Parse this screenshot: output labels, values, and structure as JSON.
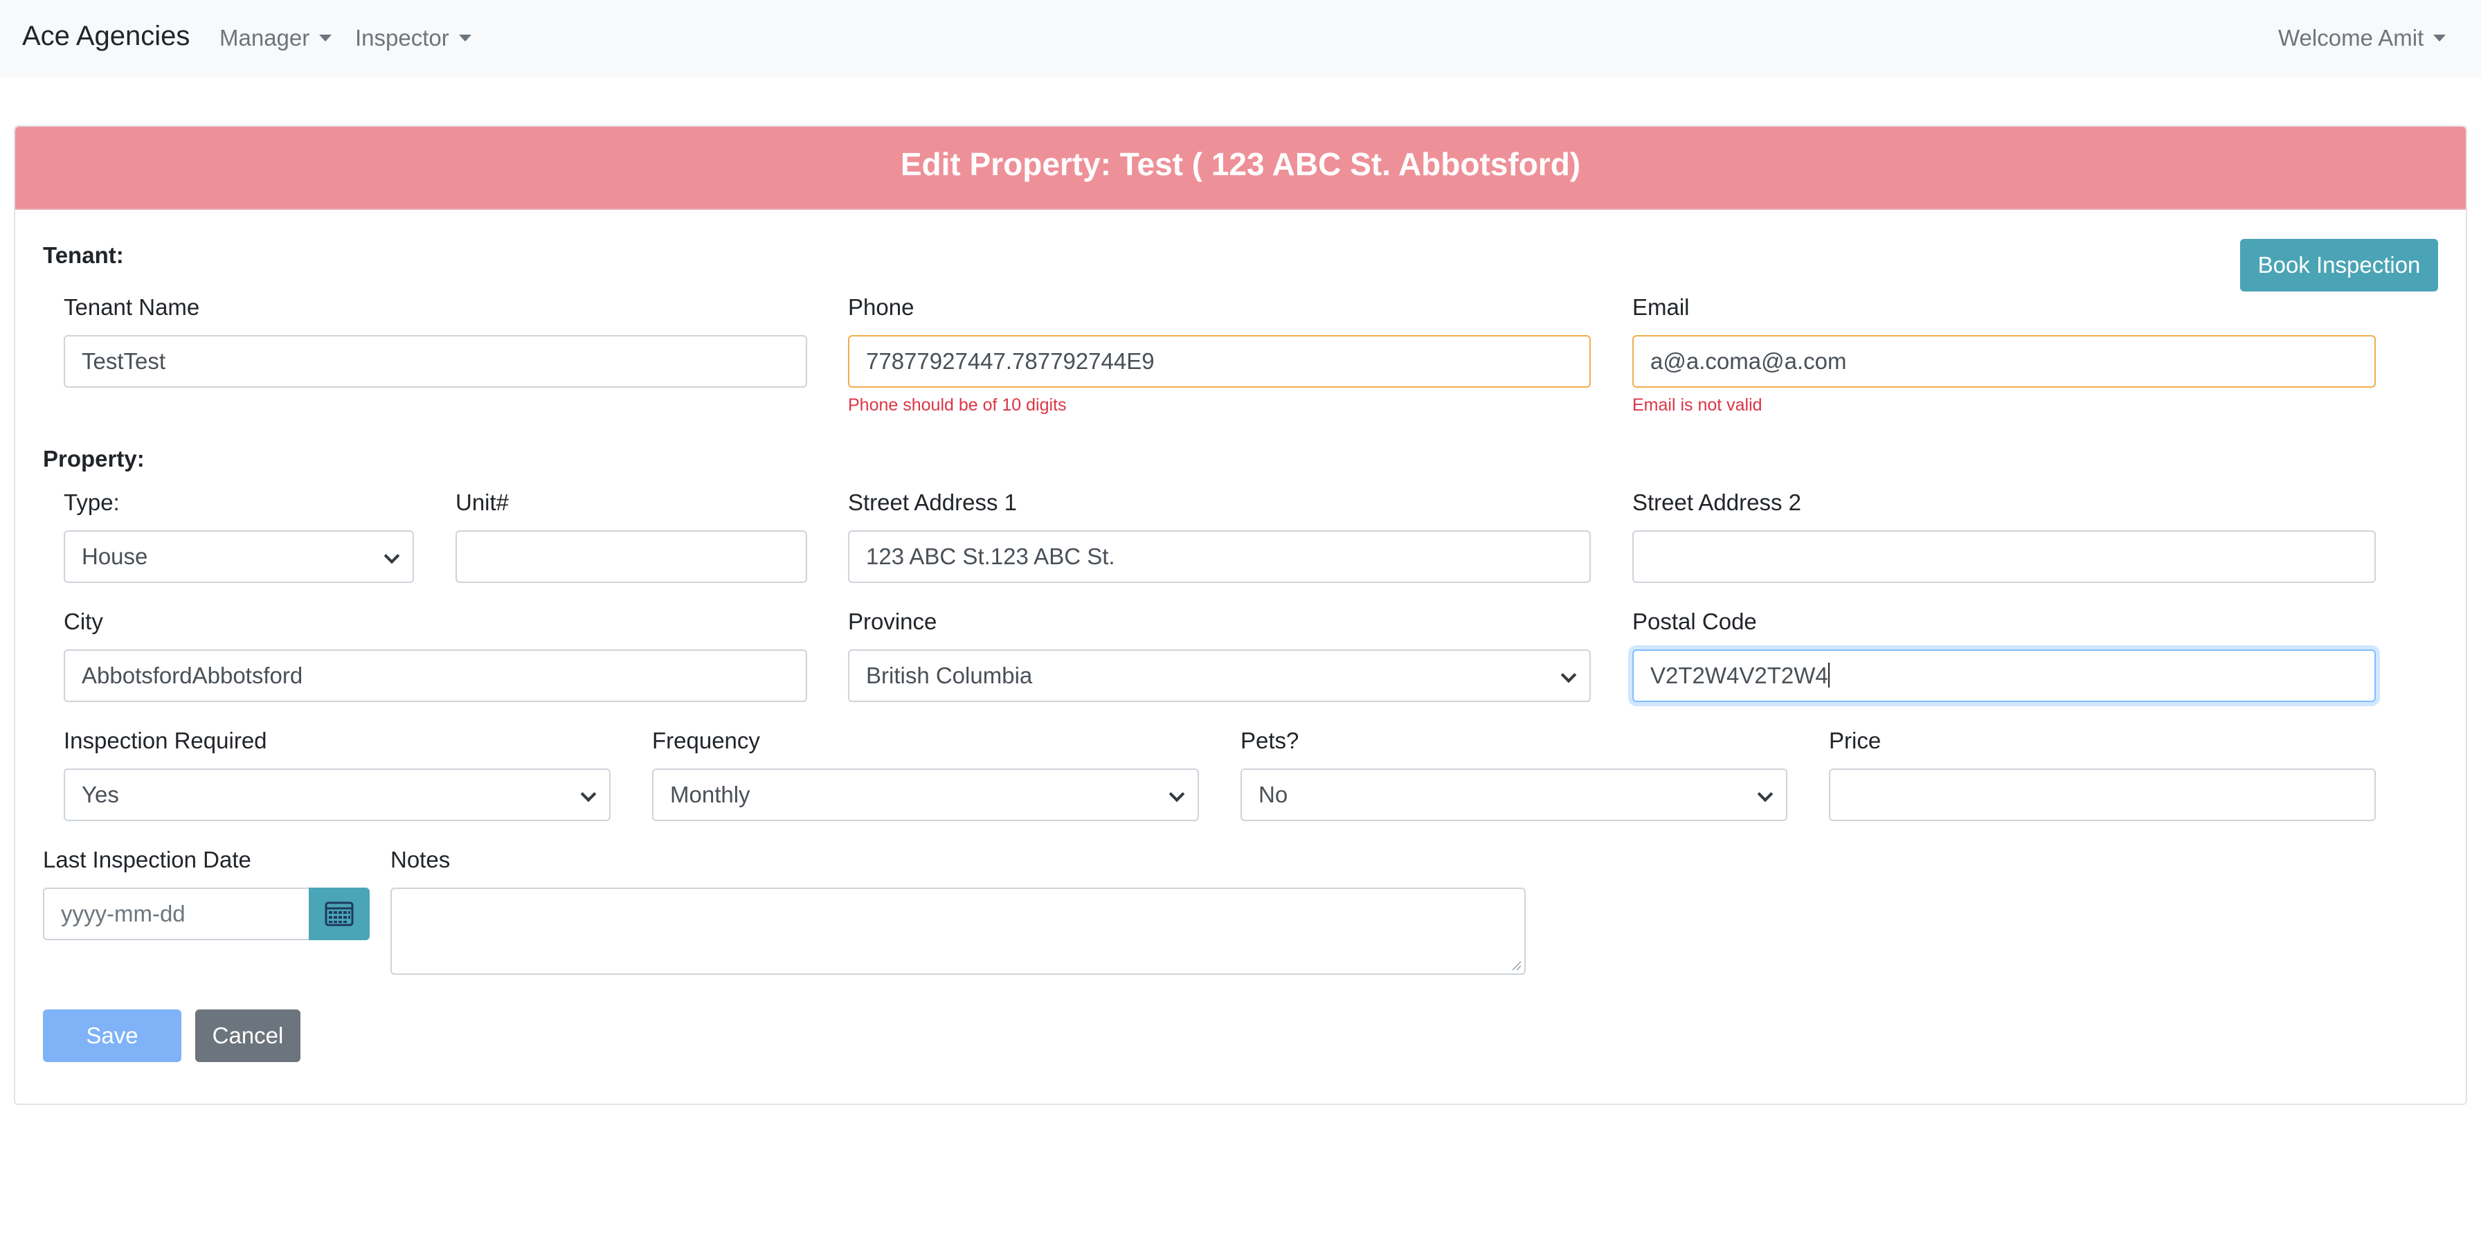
{
  "navbar": {
    "brand": "Ace Agencies",
    "menus": [
      "Manager",
      "Inspector"
    ],
    "user_menu": "Welcome Amit"
  },
  "card": {
    "title": "Edit Property: Test ( 123 ABC St. Abbotsford)",
    "book_button": "Book Inspection"
  },
  "tenant": {
    "section_label": "Tenant:",
    "name_label": "Tenant Name",
    "name_value": "TestTest",
    "phone_label": "Phone",
    "phone_value": "77877927447.787792744E9",
    "phone_error": "Phone should be of 10 digits",
    "email_label": "Email",
    "email_value": "a@a.coma@a.com",
    "email_error": "Email is not valid"
  },
  "property": {
    "section_label": "Property:",
    "type_label": "Type:",
    "type_value": "House",
    "unit_label": "Unit#",
    "unit_value": "",
    "street1_label": "Street Address 1",
    "street1_value": "123 ABC St.123 ABC St.",
    "street2_label": "Street Address 2",
    "street2_value": "",
    "city_label": "City",
    "city_value": "AbbotsfordAbbotsford",
    "province_label": "Province",
    "province_value": "British Columbia",
    "postal_label": "Postal Code",
    "postal_value": "V2T2W4V2T2W4",
    "inspection_required_label": "Inspection Required",
    "inspection_required_value": "Yes",
    "frequency_label": "Frequency",
    "frequency_value": "Monthly",
    "pets_label": "Pets?",
    "pets_value": "No",
    "price_label": "Price",
    "price_value": "",
    "last_inspection_label": "Last Inspection Date",
    "last_inspection_placeholder": "yyyy-mm-dd",
    "notes_label": "Notes",
    "notes_value": ""
  },
  "actions": {
    "save": "Save",
    "cancel": "Cancel"
  },
  "colors": {
    "header_bg": "#ee9098",
    "info_button": "#4ba4b5",
    "save_button": "#7fb2f6",
    "cancel_button": "#6c757d",
    "warning_border": "#f0ad4e",
    "error_text": "#dc3545",
    "focus_border": "#80bdff"
  },
  "icons": {
    "calendar": "calendar-icon",
    "dropdown": "chevron-down-icon",
    "menu_caret": "caret-down-icon"
  }
}
